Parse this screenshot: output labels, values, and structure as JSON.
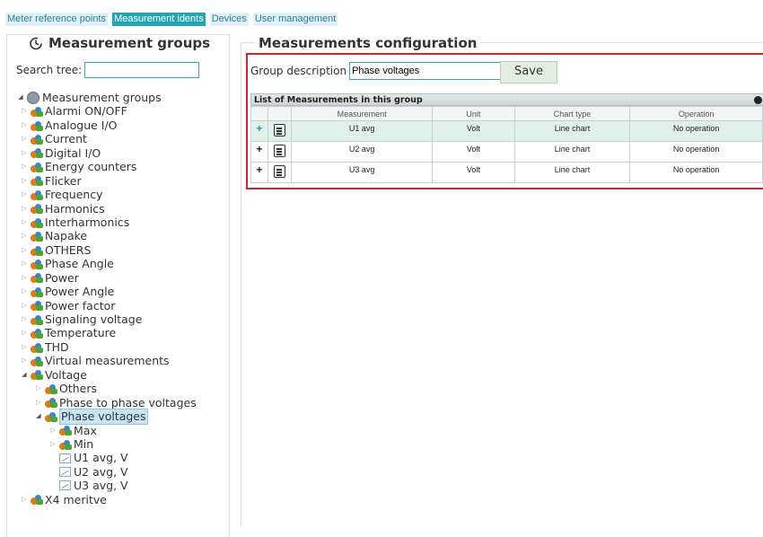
{
  "nav": {
    "tabs": [
      {
        "label": "Meter reference points",
        "active": false
      },
      {
        "label": "Measurement idents",
        "active": true
      },
      {
        "label": "Devices",
        "active": false
      },
      {
        "label": "User management",
        "active": false
      }
    ]
  },
  "left_panel": {
    "title": "Measurement groups",
    "search_label": "Search tree:",
    "search_value": ""
  },
  "tree": [
    {
      "label": "Measurement groups",
      "depth": 0,
      "state": "open",
      "icon": "globe-icon"
    },
    {
      "label": "Alarmi ON/OFF",
      "depth": 1,
      "state": "closed",
      "icon": "folder-icon"
    },
    {
      "label": "Analogue I/O",
      "depth": 1,
      "state": "closed",
      "icon": "folder-icon"
    },
    {
      "label": "Current",
      "depth": 1,
      "state": "closed",
      "icon": "folder-icon"
    },
    {
      "label": "Digital I/O",
      "depth": 1,
      "state": "closed",
      "icon": "folder-icon"
    },
    {
      "label": "Energy counters",
      "depth": 1,
      "state": "closed",
      "icon": "folder-icon"
    },
    {
      "label": "Flicker",
      "depth": 1,
      "state": "closed",
      "icon": "folder-icon"
    },
    {
      "label": "Frequency",
      "depth": 1,
      "state": "closed",
      "icon": "folder-icon"
    },
    {
      "label": "Harmonics",
      "depth": 1,
      "state": "closed",
      "icon": "folder-icon"
    },
    {
      "label": "Interharmonics",
      "depth": 1,
      "state": "closed",
      "icon": "folder-icon"
    },
    {
      "label": "Napake",
      "depth": 1,
      "state": "closed",
      "icon": "folder-icon"
    },
    {
      "label": "OTHERS",
      "depth": 1,
      "state": "closed",
      "icon": "folder-icon"
    },
    {
      "label": "Phase Angle",
      "depth": 1,
      "state": "closed",
      "icon": "folder-icon"
    },
    {
      "label": "Power",
      "depth": 1,
      "state": "closed",
      "icon": "folder-icon"
    },
    {
      "label": "Power Angle",
      "depth": 1,
      "state": "closed",
      "icon": "folder-icon"
    },
    {
      "label": "Power factor",
      "depth": 1,
      "state": "closed",
      "icon": "folder-icon"
    },
    {
      "label": "Signaling voltage",
      "depth": 1,
      "state": "closed",
      "icon": "folder-icon"
    },
    {
      "label": "Temperature",
      "depth": 1,
      "state": "closed",
      "icon": "folder-icon"
    },
    {
      "label": "THD",
      "depth": 1,
      "state": "closed",
      "icon": "folder-icon"
    },
    {
      "label": "Virtual measurements",
      "depth": 1,
      "state": "closed",
      "icon": "folder-icon"
    },
    {
      "label": "Voltage",
      "depth": 1,
      "state": "open",
      "icon": "folder-icon"
    },
    {
      "label": "Others",
      "depth": 2,
      "state": "closed",
      "icon": "folder-icon"
    },
    {
      "label": "Phase to phase voltages",
      "depth": 2,
      "state": "closed",
      "icon": "folder-icon"
    },
    {
      "label": "Phase voltages",
      "depth": 2,
      "state": "open",
      "icon": "folder-icon",
      "selected": true
    },
    {
      "label": "Max",
      "depth": 3,
      "state": "closed",
      "icon": "folder-icon"
    },
    {
      "label": "Min",
      "depth": 3,
      "state": "closed",
      "icon": "folder-icon"
    },
    {
      "label": "U1 avg, V",
      "depth": 3,
      "state": "leaf",
      "icon": "line-chart-icon"
    },
    {
      "label": "U2 avg, V",
      "depth": 3,
      "state": "leaf",
      "icon": "line-chart-icon"
    },
    {
      "label": "U3 avg, V",
      "depth": 3,
      "state": "leaf",
      "icon": "line-chart-icon"
    },
    {
      "label": "X4 meritve",
      "depth": 1,
      "state": "closed",
      "icon": "folder-icon"
    }
  ],
  "right_panel": {
    "title": "Measurements configuration",
    "group_description_label": "Group description",
    "group_description_value": "Phase voltages",
    "save_label": "Save"
  },
  "grid": {
    "caption": "List of Measurements in this group",
    "columns": [
      "Measurement",
      "Unit",
      "Chart type",
      "Operation"
    ],
    "rows": [
      {
        "measurement": "U1 avg",
        "unit": "Volt",
        "chart_type": "Line chart",
        "operation": "No operation",
        "highlight": true
      },
      {
        "measurement": "U2 avg",
        "unit": "Volt",
        "chart_type": "Line chart",
        "operation": "No operation",
        "highlight": false
      },
      {
        "measurement": "U3 avg",
        "unit": "Volt",
        "chart_type": "Line chart",
        "operation": "No operation",
        "highlight": false
      }
    ]
  },
  "colors": {
    "active_tab": "#22a6b3",
    "highlight_border": "#d0242a",
    "selected_node": "#c6e4f3"
  }
}
